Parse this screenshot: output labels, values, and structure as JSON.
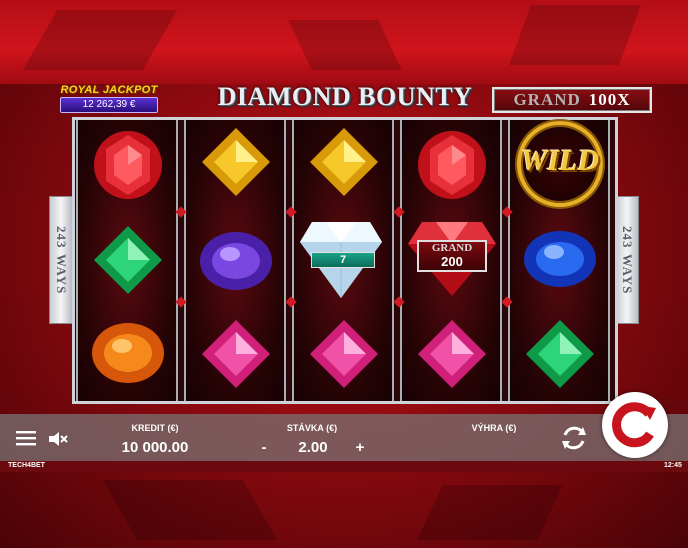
{
  "jackpot": {
    "title": "ROYAL JACKPOT",
    "value": "12 262,39 €"
  },
  "game": {
    "title": "DIAMOND BOUNTY"
  },
  "grand": {
    "label": "GRAND",
    "multiplier": "100X"
  },
  "ways": {
    "number": "243",
    "label": "WAYS"
  },
  "reels": [
    [
      "ruby-round",
      "emerald-square",
      "amber-oval"
    ],
    [
      "topaz-square",
      "amethyst-oval",
      "pink-square"
    ],
    [
      "topaz-square",
      "diamond",
      "pink-square"
    ],
    [
      "ruby-round",
      "grand-ruby",
      "pink-square"
    ],
    [
      "wild",
      "sapphire-oval",
      "emerald-square"
    ]
  ],
  "symbols": {
    "diamond_value": "7",
    "grand_label": "GRAND",
    "grand_value": "200",
    "wild_label": "WILD"
  },
  "bar": {
    "credit_label": "KREDIT (€)",
    "credit_value": "10 000.00",
    "stake_label": "STÁVKA (€)",
    "stake_value": "2.00",
    "stake_minus": "-",
    "stake_plus": "+",
    "win_label": "VÝHRA (€)",
    "win_value": ""
  },
  "footer": {
    "brand": "TECH4BET",
    "clock": "12:45"
  },
  "icons": [
    "menu-icon",
    "sound-muted-icon",
    "autoplay-icon",
    "spin-icon"
  ],
  "colors": {
    "accent_red": "#d0141c",
    "panel_gray": "#7a6e70",
    "gold": "#e8b026"
  }
}
